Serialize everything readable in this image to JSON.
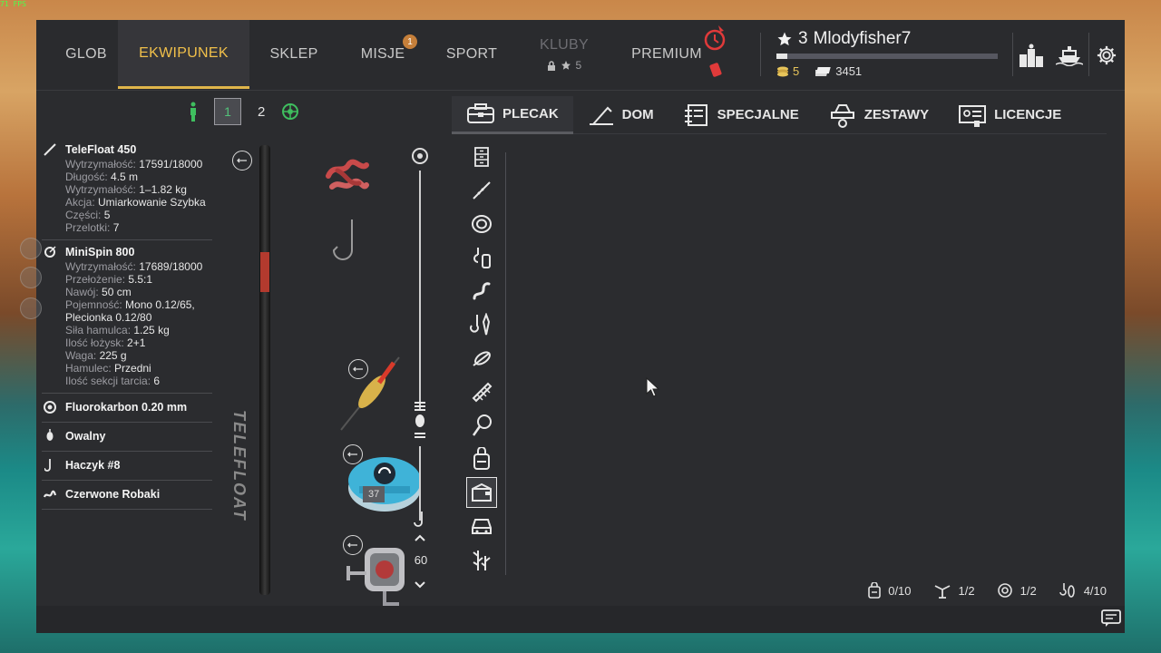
{
  "fps": "71 FPS",
  "nav": {
    "tabs": [
      {
        "label": "GLOB"
      },
      {
        "label": "EKWIPUNEK"
      },
      {
        "label": "SKLEP"
      },
      {
        "label": "MISJE",
        "badge": "1"
      },
      {
        "label": "SPORT"
      },
      {
        "label": "KLUBY",
        "sub": "5"
      },
      {
        "label": "PREMIUM"
      }
    ]
  },
  "profile": {
    "level": "3",
    "name": "Mlodyfisher7",
    "xp_fraction": 0.05,
    "gold": "5",
    "silver": "3451"
  },
  "sets": {
    "active": "1",
    "other": "2"
  },
  "equipment": {
    "rod": {
      "name": "TeleFloat 450",
      "props": [
        {
          "k": "Wytrzymałość:",
          "v": "17591/18000"
        },
        {
          "k": "Długość:",
          "v": "4.5 m"
        },
        {
          "k": "Wytrzymałość:",
          "v": "1–1.82 kg"
        },
        {
          "k": "Akcja:",
          "v": "Umiarkowanie Szybka"
        },
        {
          "k": "Części:",
          "v": "5"
        },
        {
          "k": "Przelotki:",
          "v": "7"
        }
      ]
    },
    "reel": {
      "name": "MiniSpin 800",
      "props": [
        {
          "k": "Wytrzymałość:",
          "v": "17689/18000"
        },
        {
          "k": "Przełożenie:",
          "v": "5.5:1"
        },
        {
          "k": "Nawój:",
          "v": "50 cm"
        },
        {
          "k": "Pojemność:",
          "v": "Mono 0.12/65, Plecionka 0.12/80"
        },
        {
          "k": "Siła hamulca:",
          "v": "1.25 kg"
        },
        {
          "k": "Ilość łożysk:",
          "v": "2+1"
        },
        {
          "k": "Waga:",
          "v": "225 g"
        },
        {
          "k": "Hamulec:",
          "v": "Przedni"
        },
        {
          "k": "Ilość sekcji tarcia:",
          "v": "6"
        }
      ]
    },
    "line": "Fluorokarbon 0.20 mm",
    "float": "Owalny",
    "hook": "Haczyk #8",
    "bait": "Czerwone Robaki"
  },
  "rod_display": {
    "label": "TELEFLOAT",
    "line_qty": "37",
    "depth": "60"
  },
  "categories": [
    {
      "label": "PLECAK",
      "icon": "backpack-icon"
    },
    {
      "label": "DOM",
      "icon": "home-icon"
    },
    {
      "label": "SPECJALNE",
      "icon": "special-icon"
    },
    {
      "label": "ZESTAWY",
      "icon": "sets-icon"
    },
    {
      "label": "LICENCJE",
      "icon": "license-icon"
    }
  ],
  "capacity": {
    "chum": "0/10",
    "rods": "1/2",
    "lines": "1/2",
    "tackle": "4/10"
  }
}
